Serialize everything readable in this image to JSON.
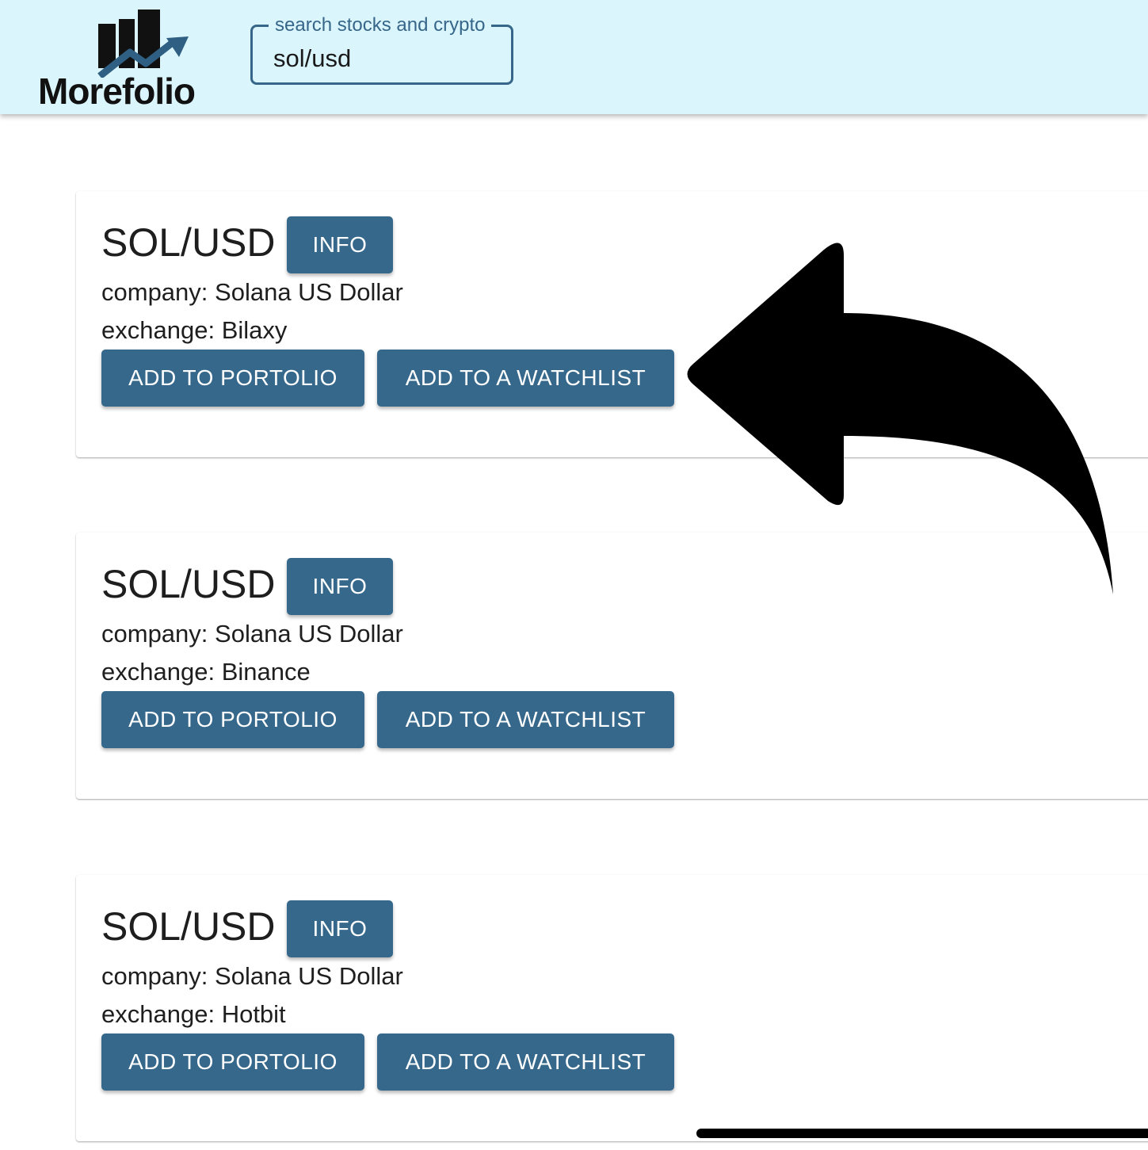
{
  "header": {
    "logo_text": "Morefolio",
    "search": {
      "label": "search stocks and crypto",
      "value": "sol/usd"
    }
  },
  "results": [
    {
      "symbol": "SOL/USD",
      "info_label": "INFO",
      "company_label": "company:",
      "company": "Solana US Dollar",
      "exchange_label": "exchange:",
      "exchange": "Bilaxy",
      "add_portfolio_label": "ADD TO PORTOLIO",
      "add_watchlist_label": "ADD TO A WATCHLIST"
    },
    {
      "symbol": "SOL/USD",
      "info_label": "INFO",
      "company_label": "company:",
      "company": "Solana US Dollar",
      "exchange_label": "exchange:",
      "exchange": "Binance",
      "add_portfolio_label": "ADD TO PORTOLIO",
      "add_watchlist_label": "ADD TO A WATCHLIST"
    },
    {
      "symbol": "SOL/USD",
      "info_label": "INFO",
      "company_label": "company:",
      "company": "Solana US Dollar",
      "exchange_label": "exchange:",
      "exchange": "Hotbit",
      "add_portfolio_label": "ADD TO PORTOLIO",
      "add_watchlist_label": "ADD TO A WATCHLIST"
    }
  ],
  "colors": {
    "header_bg": "#dbf5fc",
    "accent": "#36688b",
    "annotation_arrow": "#000000"
  },
  "icons": {
    "logo": "bar-chart-with-rising-arrow-icon",
    "annotation": "curved-arrow-left-icon"
  }
}
